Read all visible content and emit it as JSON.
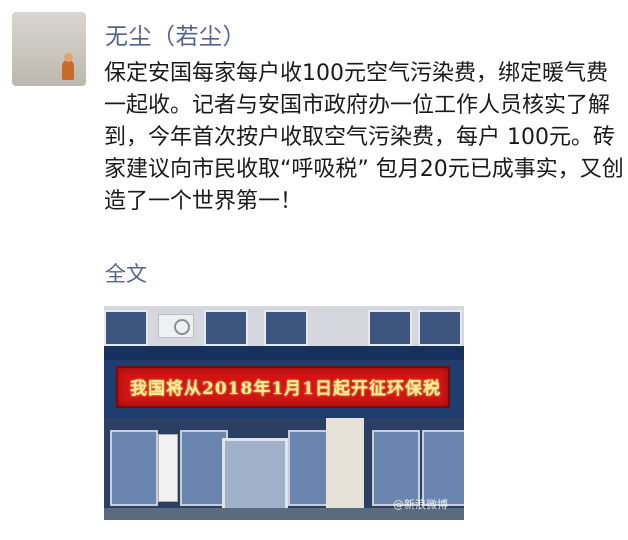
{
  "post": {
    "username": "无尘（若尘）",
    "text": "保定安国每家每户收100元空气污染费，绑定暖气费一起收。记者与安国市政府办一位工作人员核实了解到，今年首次按户收取空气污染费，每户 100元。砖家建议向市民收取“呼吸税” 包月20元已成事实，又创造了一个世界第一！",
    "full_text_link": "全文"
  },
  "photo": {
    "sign_text": "我国将从2018年1月1日起开征环保税",
    "watermark": "@新浪微博"
  },
  "colors": {
    "username": "#55648c",
    "link": "#55648c",
    "text": "#1a1a1a",
    "led_background": "#d21414",
    "led_text": "#f2ee9a"
  },
  "icons": [
    "avatar-image",
    "air-conditioner-icon"
  ]
}
